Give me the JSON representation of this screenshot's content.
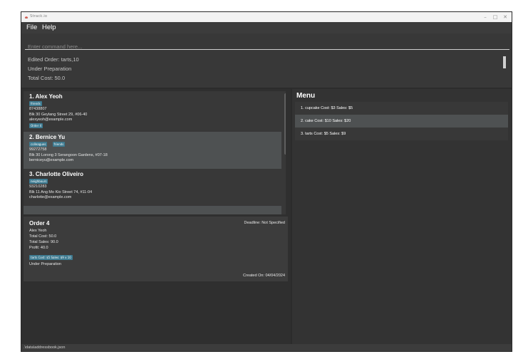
{
  "window": {
    "title": "Strack.io",
    "controls": [
      "–",
      "□",
      "✕"
    ]
  },
  "menubar": {
    "items": [
      "File",
      "Help"
    ]
  },
  "command": {
    "placeholder": "Enter command here..."
  },
  "result": {
    "lines": [
      "Edited Order: tarts,10",
      "Under Preparation",
      "Total Cost: 50.0"
    ]
  },
  "persons": [
    {
      "index_name": "1.  Alex Yeoh",
      "tags": [
        "friends"
      ],
      "phone": "87438807",
      "address": "Blk 30 Geylang Street 29, #06-40",
      "email": "alexyeoh@example.com",
      "order_tag": "Order 4"
    },
    {
      "index_name": "2.  Bernice Yu",
      "tags": [
        "colleagues",
        "friends"
      ],
      "phone": "99272758",
      "address": "Blk 30 Lorong 3 Serangoon Gardens, #07-18",
      "email": "berniceyu@example.com"
    },
    {
      "index_name": "3.  Charlotte Oliveiro",
      "tags": [
        "neighbours"
      ],
      "phone": "93210283",
      "address": "Blk 11 Ang Mo Kio Street 74, #11-04",
      "email": "charlotte@example.com"
    }
  ],
  "order": {
    "title": "Order 4",
    "deadline": "Deadline: Not Specified",
    "customer": "Alex Yeoh",
    "total_cost": "Total Cost: 50.0",
    "total_sales": "Total Sales: 90.0",
    "profit": "Profit: 40.0",
    "item_tag": "tarts Cost: $5 Sales: $9 x 10",
    "status": "Under Preparation",
    "created": "Created On: 04/04/2024"
  },
  "menu": {
    "title": "Menu",
    "items": [
      "1. cupcake Cost: $3 Sales: $5",
      "2. cake Cost: $10 Sales: $20",
      "3. tarts Cost: $5 Sales: $9"
    ]
  },
  "status_bar": {
    "path": ".\\data\\addressbook.json"
  },
  "colors": {
    "background": "#383838",
    "tag": "#3e7b91",
    "selected_row": "#4e5152",
    "text": "#ffffff"
  }
}
